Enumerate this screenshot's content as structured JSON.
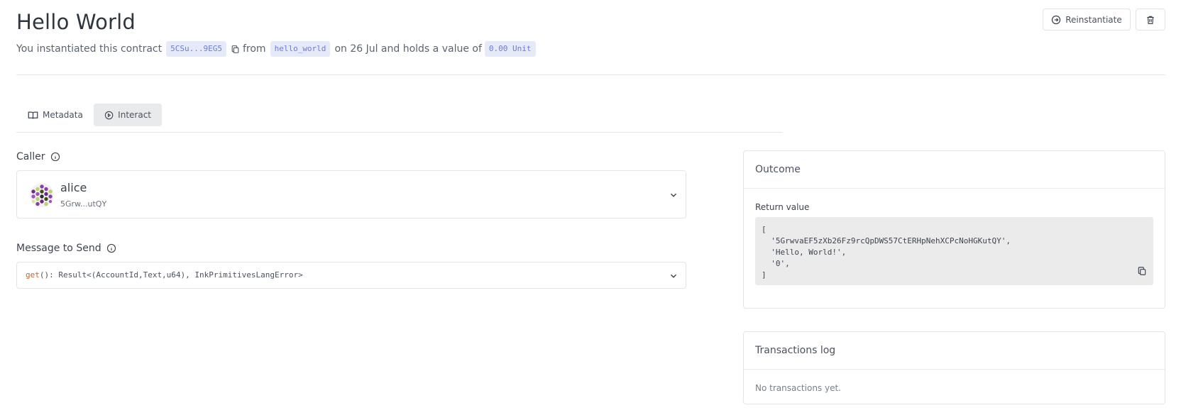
{
  "header": {
    "title": "Hello World",
    "subtitle_prefix": "You instantiated this contract",
    "contract_address": "5CSu...9EG5",
    "from_text": "from",
    "code_name": "hello_world",
    "date_text": "on 26 Jul and holds a value of",
    "value": "0.00 Unit",
    "reinstantiate_label": "Reinstantiate"
  },
  "tabs": [
    {
      "label": "Metadata",
      "active": false
    },
    {
      "label": "Interact",
      "active": true
    }
  ],
  "caller": {
    "label": "Caller",
    "name": "alice",
    "address": "5Grw...utQY"
  },
  "message": {
    "label": "Message to Send",
    "fn_name": "get",
    "signature": "(): Result<(AccountId,Text,u64), InkPrimitivesLangError>"
  },
  "outcome": {
    "title": "Outcome",
    "return_label": "Return value",
    "return_value": "[\n  '5GrwvaEF5zXb26Fz9rcQpDWS57CtERHpNehXCPcNoHGKutQY',\n  'Hello, World!',\n  '0',\n]"
  },
  "transactions": {
    "title": "Transactions log",
    "empty_text": "No transactions yet."
  },
  "colors": {
    "pill_bg": "#e6eaf8",
    "pill_text": "#6d7bd6",
    "fn_color": "#c2662b",
    "active_tab_bg": "#e9eaec"
  }
}
